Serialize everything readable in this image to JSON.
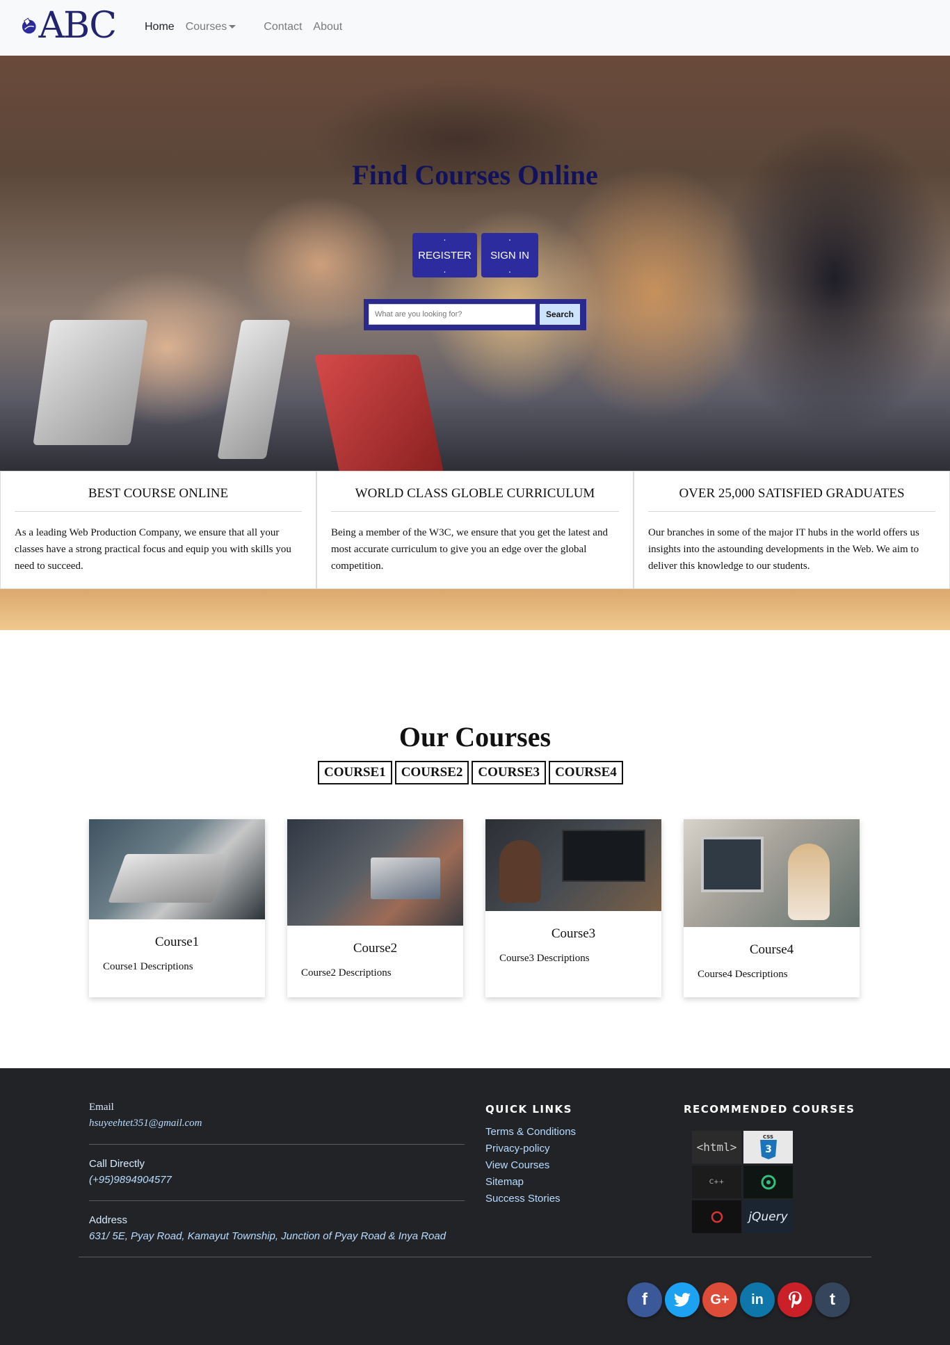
{
  "nav": {
    "logo_text": "ABC",
    "items": [
      {
        "label": "Home"
      },
      {
        "label": "Courses"
      },
      {
        "label": "Contact"
      },
      {
        "label": "About"
      }
    ]
  },
  "hero": {
    "title": "Find Courses Online",
    "register_label": "REGISTER",
    "signin_label": "SIGN IN",
    "search_placeholder": "What are you looking for?",
    "search_button": "Search",
    "colors": {
      "button": "#2c2c9e",
      "title": "#12125a"
    }
  },
  "features": [
    {
      "title": "BEST COURSE ONLINE",
      "text": "As a leading Web Production Company, we ensure that all your classes have a strong practical focus and equip you with skills you need to succeed."
    },
    {
      "title": "WORLD CLASS GLOBLE CURRICULUM",
      "text": "Being a member of the W3C, we ensure that you get the latest and most accurate curriculum to give you an edge over the global competition."
    },
    {
      "title": "OVER 25,000 SATISFIED GRADUATES",
      "text": "Our branches in some of the major IT hubs in the world offers us insights into the astounding developments in the Web. We aim to deliver this knowledge to our students."
    }
  ],
  "courses": {
    "title": "Our Courses",
    "tabs": [
      "COURSE1",
      "COURSE2",
      "COURSE3",
      "COURSE4"
    ],
    "cards": [
      {
        "title": "Course1",
        "desc": "Course1 Descriptions"
      },
      {
        "title": "Course2",
        "desc": "Course2 Descriptions"
      },
      {
        "title": "Course3",
        "desc": "Course3 Descriptions"
      },
      {
        "title": "Course4",
        "desc": "Course4 Descriptions"
      }
    ]
  },
  "footer": {
    "email_label": "Email",
    "email_value": "hsuyeehtet351@gmail.com",
    "phone_label": "Call Directly",
    "phone_value": "(+95)9894904577",
    "address_label": "Address",
    "address_value": "631/ 5E, Pyay Road, Kamayut Township, Junction of Pyay Road & Inya Road",
    "quick_links_title": "QUICK LINKS",
    "quick_links": [
      "Terms & Conditions",
      "Privacy-policy",
      "View Courses",
      "Sitemap",
      "Success Stories"
    ],
    "recommended_title": "RECOMMENDED COURSES",
    "recommended": [
      {
        "label": "<html>",
        "icon": "html-icon"
      },
      {
        "label": "CSS",
        "icon": "css3-icon"
      },
      {
        "label": "C++",
        "icon": "cpp-icon"
      },
      {
        "label": "",
        "icon": "green-logo-icon"
      },
      {
        "label": "",
        "icon": "red-logo-icon"
      },
      {
        "label": "jQuery",
        "icon": "jquery-icon"
      }
    ],
    "socials": [
      {
        "name": "facebook-icon",
        "glyph": "f",
        "color": "#3b5998"
      },
      {
        "name": "twitter-icon",
        "glyph": "t",
        "color": "#1da1f2"
      },
      {
        "name": "google-plus-icon",
        "glyph": "G+",
        "color": "#dd4b39"
      },
      {
        "name": "linkedin-icon",
        "glyph": "in",
        "color": "#0e76a8"
      },
      {
        "name": "pinterest-icon",
        "glyph": "p",
        "color": "#cb2027"
      },
      {
        "name": "tumblr-icon",
        "glyph": "t",
        "color": "#35465c"
      }
    ]
  }
}
